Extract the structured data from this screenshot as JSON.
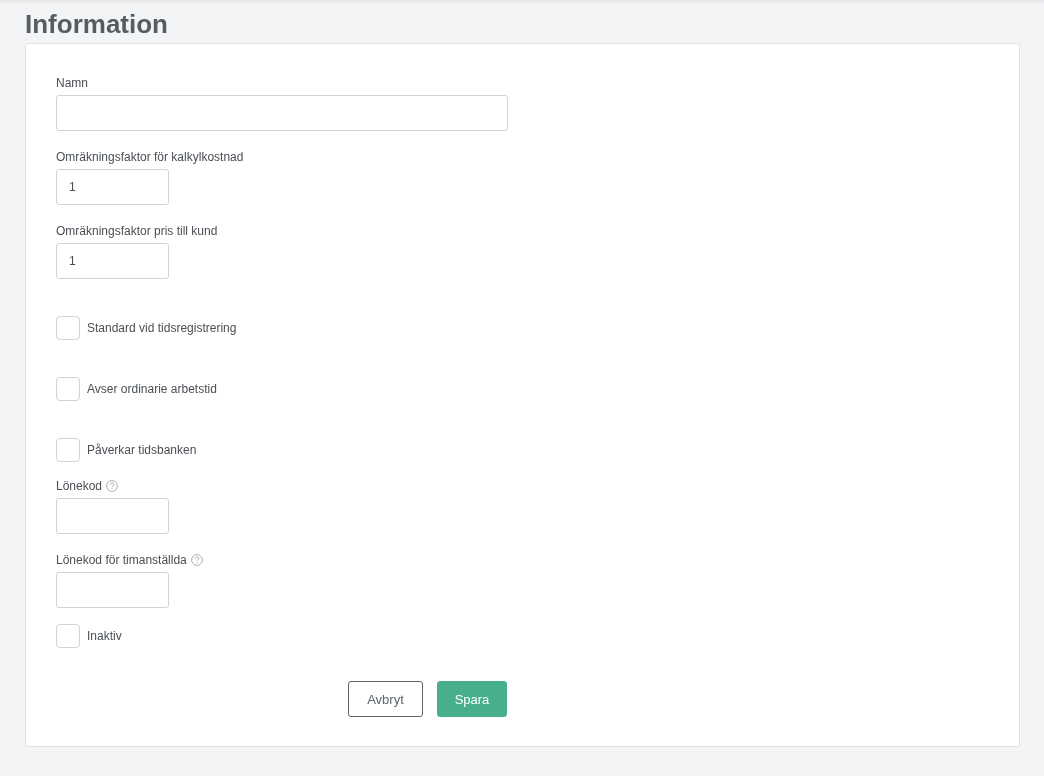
{
  "title": "Information",
  "fields": [
    {
      "kind": "wide",
      "label": "Namn"
    },
    {
      "kind": "text",
      "label": "Omräkningsfaktor för kalkylkostnad",
      "value": "1"
    },
    {
      "kind": "text",
      "label": "Omräkningsfaktor pris till kund",
      "value": "1"
    },
    {
      "kind": "checkbox",
      "label": "Standard vid tidsregistrering",
      "checked": false
    },
    {
      "kind": "checkbox",
      "label": "Avser ordinarie arbetstid",
      "checked": false
    },
    {
      "kind": "checkbox",
      "label": "Påverkar tidsbanken",
      "checked": false
    },
    {
      "kind": "text",
      "label": "Lönekod",
      "help": true
    },
    {
      "kind": "text",
      "label": "Lönekod för timanställda",
      "help": true
    },
    {
      "kind": "checkbox",
      "label": "Inaktiv",
      "checked": false
    }
  ],
  "buttons": [
    {
      "label": "Avbryt",
      "kind": "secondary"
    },
    {
      "label": "Spara",
      "kind": "primary"
    }
  ]
}
